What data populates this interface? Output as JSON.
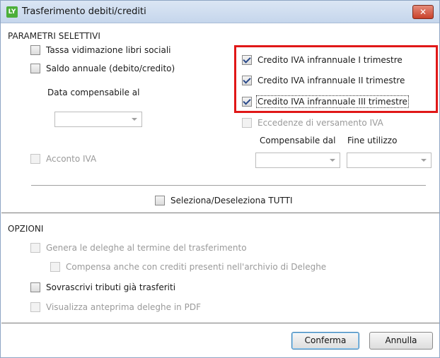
{
  "window": {
    "title": "Trasferimento debiti/crediti",
    "icon_text": "LY",
    "close_symbol": "✕"
  },
  "parametri": {
    "section_title": "PARAMETRI SELETTIVI",
    "tassa_label": "Tassa vidimazione libri sociali",
    "saldo_label": "Saldo annuale (debito/credito)",
    "data_compensabile_label": "Data compensabile al",
    "acconto_label": "Acconto IVA",
    "credito_1_label": "Credito IVA infrannuale I trimestre",
    "credito_2_label": "Credito IVA infrannuale II trimestre",
    "credito_3_label": "Credito IVA infrannuale III trimestre",
    "eccedenze_label": "Eccedenze di versamento IVA",
    "compensabile_dal_label": "Compensabile dal",
    "fine_utilizzo_label": "Fine utilizzo",
    "seleziona_label": "Seleziona/Deseleziona TUTTI"
  },
  "opzioni": {
    "section_title": "OPZIONI",
    "genera_label": "Genera le deleghe al termine del trasferimento",
    "compensa_label": "Compensa anche con crediti presenti nell'archivio di Deleghe",
    "sovrascrivi_label": "Sovrascrivi tributi già trasferiti",
    "visualizza_label": "Visualizza anteprima deleghe in PDF"
  },
  "buttons": {
    "confirm_label": "Conferma",
    "cancel_label": "Annulla"
  },
  "colors": {
    "highlight": "#e01818",
    "titlebar": "#c5d6ec"
  }
}
